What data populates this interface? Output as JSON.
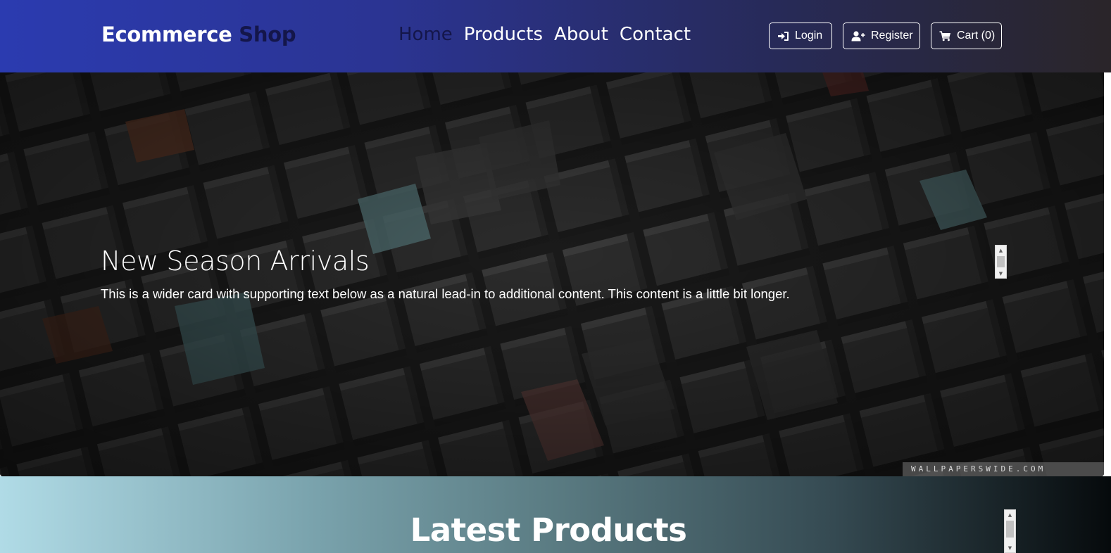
{
  "navbar": {
    "brand_main": "Ecommerce",
    "brand_accent": "Shop",
    "links": [
      {
        "label": "Home",
        "active": true
      },
      {
        "label": "Products",
        "active": false
      },
      {
        "label": "About",
        "active": false
      },
      {
        "label": "Contact",
        "active": false
      }
    ],
    "buttons": {
      "login": {
        "label": "Login",
        "icon": "sign-in-icon"
      },
      "register": {
        "label": "Register",
        "icon": "user-plus-icon"
      },
      "cart": {
        "label": "Cart (0)",
        "icon": "shopping-cart-icon"
      }
    },
    "colors": {
      "gradient_start": "#2b3bb0",
      "gradient_end": "#2a2529",
      "accent_text": "#14164a"
    }
  },
  "hero": {
    "title": "New Season Arrivals",
    "text": "This is a wider card with supporting text below as a natural lead-in to additional content. This content is a little bit longer.",
    "watermark": "WALLPAPERSWIDE.COM"
  },
  "products_section": {
    "title": "Latest Products"
  }
}
